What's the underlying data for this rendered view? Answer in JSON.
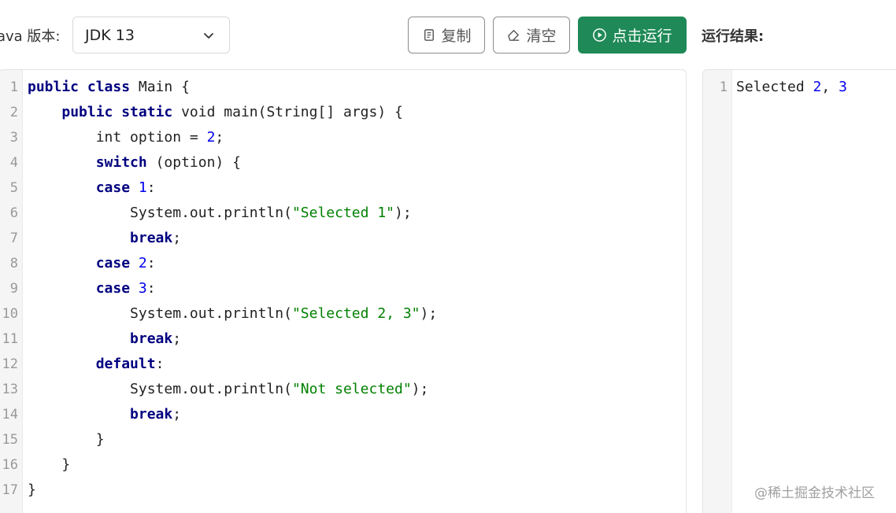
{
  "toolbar": {
    "java_version_label": "ava 版本:",
    "jdk_selected": "JDK 13",
    "copy_label": "复制",
    "clear_label": "清空",
    "run_label": "点击运行",
    "result_title": "运行结果:",
    "run_button_color": "#1f8a57"
  },
  "icons": {
    "select_chevron": "chevron-down-icon",
    "copy": "copy-icon",
    "clear": "eraser-icon",
    "run": "play-circle-icon"
  },
  "editor": {
    "lines": [
      {
        "n": "1",
        "tokens": [
          {
            "t": "public class",
            "c": "kw"
          },
          {
            "t": " Main {",
            "c": ""
          }
        ]
      },
      {
        "n": "2",
        "tokens": [
          {
            "t": "    ",
            "c": ""
          },
          {
            "t": "public static",
            "c": "kw"
          },
          {
            "t": " void main(String[] args) {",
            "c": ""
          }
        ]
      },
      {
        "n": "3",
        "tokens": [
          {
            "t": "        int option = ",
            "c": ""
          },
          {
            "t": "2",
            "c": "num"
          },
          {
            "t": ";",
            "c": ""
          }
        ]
      },
      {
        "n": "4",
        "tokens": [
          {
            "t": "        ",
            "c": ""
          },
          {
            "t": "switch",
            "c": "kw"
          },
          {
            "t": " (option) {",
            "c": ""
          }
        ]
      },
      {
        "n": "5",
        "tokens": [
          {
            "t": "        ",
            "c": ""
          },
          {
            "t": "case",
            "c": "kw"
          },
          {
            "t": " ",
            "c": ""
          },
          {
            "t": "1",
            "c": "num"
          },
          {
            "t": ":",
            "c": ""
          }
        ]
      },
      {
        "n": "6",
        "tokens": [
          {
            "t": "            System.out.println(",
            "c": ""
          },
          {
            "t": "\"Selected 1\"",
            "c": "str"
          },
          {
            "t": ");",
            "c": ""
          }
        ]
      },
      {
        "n": "7",
        "tokens": [
          {
            "t": "            ",
            "c": ""
          },
          {
            "t": "break",
            "c": "kw"
          },
          {
            "t": ";",
            "c": ""
          }
        ]
      },
      {
        "n": "8",
        "tokens": [
          {
            "t": "        ",
            "c": ""
          },
          {
            "t": "case",
            "c": "kw"
          },
          {
            "t": " ",
            "c": ""
          },
          {
            "t": "2",
            "c": "num"
          },
          {
            "t": ":",
            "c": ""
          }
        ]
      },
      {
        "n": "9",
        "tokens": [
          {
            "t": "        ",
            "c": ""
          },
          {
            "t": "case",
            "c": "kw"
          },
          {
            "t": " ",
            "c": ""
          },
          {
            "t": "3",
            "c": "num"
          },
          {
            "t": ":",
            "c": ""
          }
        ]
      },
      {
        "n": "10",
        "tokens": [
          {
            "t": "            System.out.println(",
            "c": ""
          },
          {
            "t": "\"Selected 2, 3\"",
            "c": "str"
          },
          {
            "t": ");",
            "c": ""
          }
        ]
      },
      {
        "n": "11",
        "tokens": [
          {
            "t": "            ",
            "c": ""
          },
          {
            "t": "break",
            "c": "kw"
          },
          {
            "t": ";",
            "c": ""
          }
        ]
      },
      {
        "n": "12",
        "tokens": [
          {
            "t": "        ",
            "c": ""
          },
          {
            "t": "default",
            "c": "kw"
          },
          {
            "t": ":",
            "c": ""
          }
        ]
      },
      {
        "n": "13",
        "tokens": [
          {
            "t": "            System.out.println(",
            "c": ""
          },
          {
            "t": "\"Not selected\"",
            "c": "str"
          },
          {
            "t": ");",
            "c": ""
          }
        ]
      },
      {
        "n": "14",
        "tokens": [
          {
            "t": "            ",
            "c": ""
          },
          {
            "t": "break",
            "c": "kw"
          },
          {
            "t": ";",
            "c": ""
          }
        ]
      },
      {
        "n": "15",
        "tokens": [
          {
            "t": "        }",
            "c": ""
          }
        ]
      },
      {
        "n": "16",
        "tokens": [
          {
            "t": "    }",
            "c": ""
          }
        ]
      },
      {
        "n": "17",
        "tokens": [
          {
            "t": "}",
            "c": ""
          }
        ]
      }
    ]
  },
  "result": {
    "lines": [
      {
        "n": "1",
        "tokens": [
          {
            "t": "Selected ",
            "c": ""
          },
          {
            "t": "2",
            "c": "num"
          },
          {
            "t": ", ",
            "c": ""
          },
          {
            "t": "3",
            "c": "num"
          }
        ]
      }
    ]
  },
  "watermark": "@稀土掘金技术社区"
}
